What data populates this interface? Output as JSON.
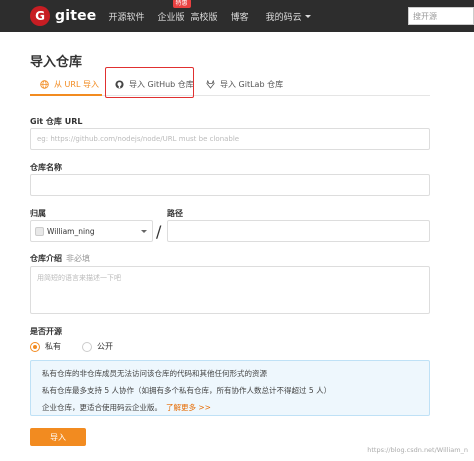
{
  "nav": {
    "brand": "gitee",
    "logo_letter": "G",
    "items": [
      "开源软件",
      "企业版",
      "高校版",
      "博客"
    ],
    "badge": "特惠",
    "mine": "我的码云",
    "search_placeholder": "搜开源"
  },
  "page": {
    "title": "导入仓库"
  },
  "tabs": [
    {
      "label": "从 URL 导入",
      "active": true
    },
    {
      "label": "导入 GitHub 仓库",
      "active": false
    },
    {
      "label": "导入 GitLab 仓库",
      "active": false
    }
  ],
  "form": {
    "git_url_label": "Git 仓库 URL",
    "git_url_placeholder": "eg: https://github.com/nodejs/node/URL must be clonable",
    "repo_name_label": "仓库名称",
    "owner_label": "归属",
    "owner_value": "William_ning",
    "path_label": "路径",
    "path_separator": "/",
    "desc_label": "仓库介绍",
    "desc_hint": "非必填",
    "desc_placeholder": "用简短的语言来描述一下吧",
    "open_source_label": "是否开源",
    "private_label": "私有",
    "public_label": "公开"
  },
  "info": {
    "line1": "私有仓库的非仓库成员无法访问该仓库的代码和其他任何形式的资源",
    "line2": "私有仓库最多支持 5 人协作（如拥有多个私有仓库，所有协作人数总计不得超过 5 人）",
    "line3": "企业仓库，更适合使用码云企业版。",
    "link": "了解更多 >>"
  },
  "submit_label": "导入",
  "watermark": "https://blog.csdn.net/William_n",
  "colors": {
    "accent": "#f28b20",
    "nav_bg": "#2d2d2d",
    "brand_red": "#c71d23",
    "highlight": "#e03030"
  }
}
